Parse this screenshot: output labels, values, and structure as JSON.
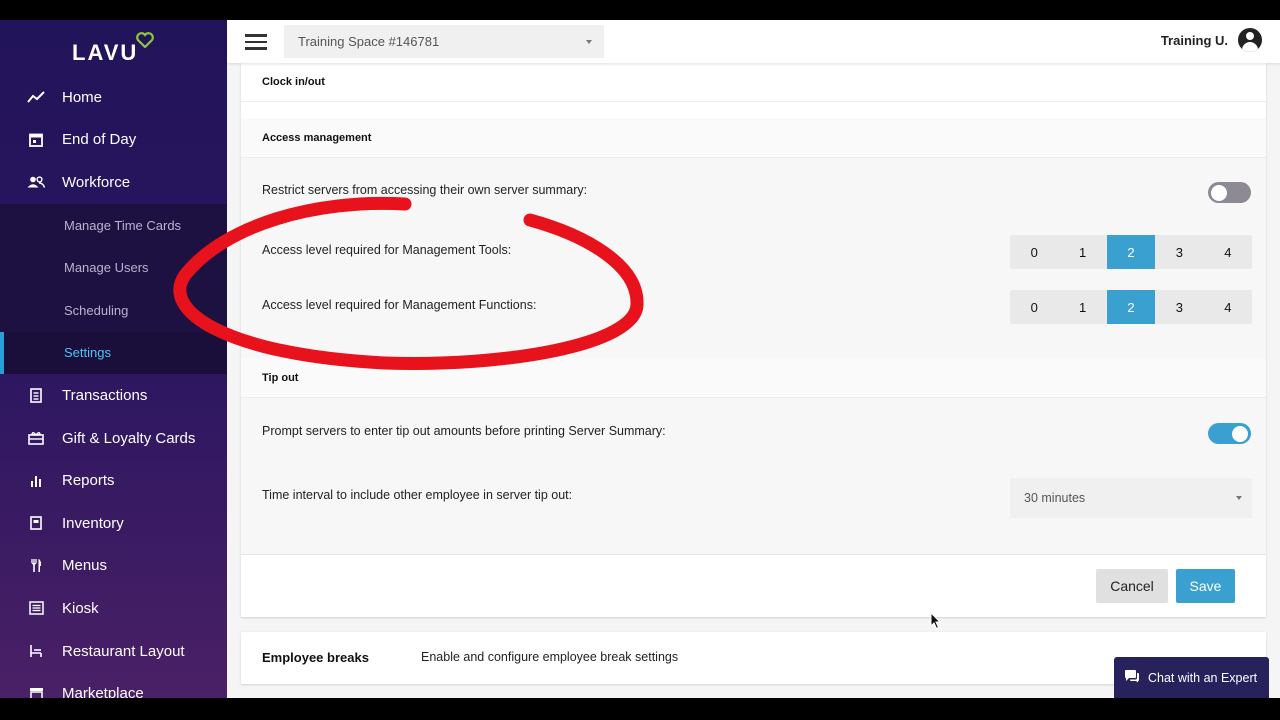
{
  "logo": {
    "text": "LAVU"
  },
  "sidebar": {
    "items": [
      {
        "label": "Home",
        "icon": "trend-icon"
      },
      {
        "label": "End of Day",
        "icon": "calendar-icon"
      },
      {
        "label": "Workforce",
        "icon": "people-icon"
      }
    ],
    "subitems": [
      {
        "label": "Manage Time Cards"
      },
      {
        "label": "Manage Users"
      },
      {
        "label": "Scheduling"
      },
      {
        "label": "Settings",
        "active": true
      }
    ],
    "items_after": [
      {
        "label": "Transactions",
        "icon": "receipt-icon"
      },
      {
        "label": "Gift & Loyalty Cards",
        "icon": "gift-card-icon"
      },
      {
        "label": "Reports",
        "icon": "bar-chart-icon"
      },
      {
        "label": "Inventory",
        "icon": "inventory-icon"
      },
      {
        "label": "Menus",
        "icon": "utensils-icon"
      },
      {
        "label": "Kiosk",
        "icon": "kiosk-icon"
      },
      {
        "label": "Restaurant Layout",
        "icon": "layout-icon"
      },
      {
        "label": "Marketplace",
        "icon": "store-icon"
      }
    ]
  },
  "topbar": {
    "space": "Training Space #146781",
    "user": "Training U."
  },
  "sections": {
    "clock": "Clock in/out",
    "access": "Access management",
    "tipout": "Tip out"
  },
  "settings": {
    "restrict_label": "Restrict servers from accessing their own server summary:",
    "restrict_on": false,
    "mgmt_tools_label": "Access level required for Management Tools:",
    "mgmt_functions_label": "Access level required for Management Functions:",
    "levels": [
      "0",
      "1",
      "2",
      "3",
      "4"
    ],
    "mgmt_tools_selected": "2",
    "mgmt_functions_selected": "2",
    "prompt_label": "Prompt servers to enter tip out amounts before printing Server Summary:",
    "prompt_on": true,
    "interval_label": "Time interval to include other employee in server tip out:",
    "interval_value": "30 minutes"
  },
  "buttons": {
    "cancel": "Cancel",
    "save": "Save"
  },
  "breaks": {
    "title": "Employee breaks",
    "description": "Enable and configure employee break settings"
  },
  "chat": {
    "label": "Chat with an Expert"
  },
  "colors": {
    "accent": "#3aa0d0",
    "sidebar": "#22145a",
    "logo_heart": "#8dc63f",
    "annotation": "#e8121c"
  }
}
